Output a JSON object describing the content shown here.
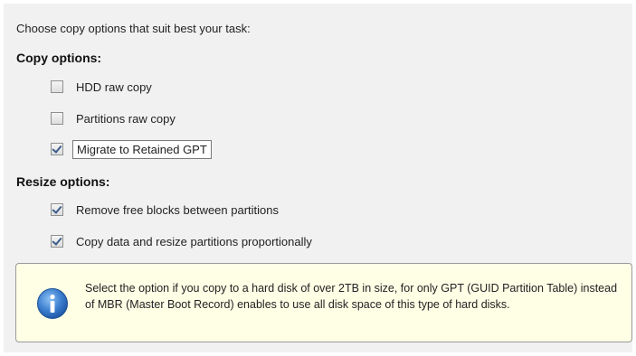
{
  "intro_text": "Choose copy options that suit best your task:",
  "copy_options": {
    "title": "Copy options:",
    "items": [
      {
        "label": "HDD raw copy",
        "checked": false
      },
      {
        "label": "Partitions raw copy",
        "checked": false
      },
      {
        "label": "Migrate to Retained GPT",
        "checked": true
      }
    ]
  },
  "resize_options": {
    "title": "Resize options:",
    "items": [
      {
        "label": "Remove free blocks between partitions",
        "checked": true
      },
      {
        "label": "Copy data and resize partitions proportionally",
        "checked": true
      }
    ]
  },
  "info": {
    "icon": "info-icon",
    "text": "Select the option if you copy to a hard disk of over 2TB in size, for only GPT (GUID Partition Table) instead of MBR (Master Boot Record) enables to use all disk space of this type of hard disks."
  },
  "colors": {
    "panel_background": "#f1f1f1",
    "info_background": "#ffffe6",
    "info_icon": "#2f6fc0",
    "checkmark": "#3c5b8a"
  }
}
